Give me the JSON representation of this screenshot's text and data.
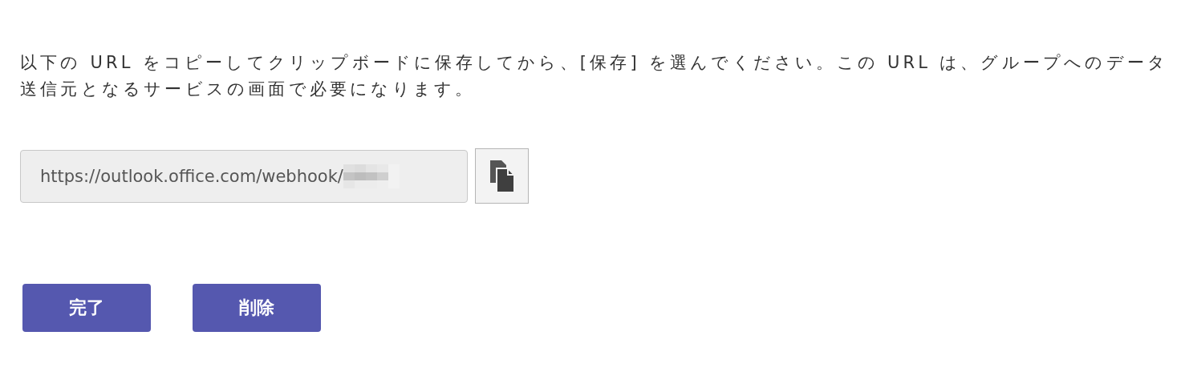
{
  "instructions": "以下の URL をコピーしてクリップボードに保存してから、[保存] を選んでください。この URL は、グループへのデータ送信元となるサービスの画面で必要になります。",
  "url_field": {
    "value": "https://outlook.office.com/webhook/",
    "redacted": true
  },
  "buttons": [
    {
      "label": "完了"
    },
    {
      "label": "削除"
    }
  ]
}
